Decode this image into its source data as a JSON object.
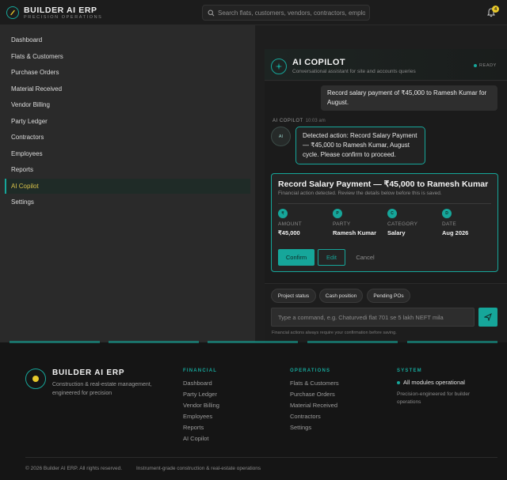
{
  "header": {
    "brand_title": "BUILDER AI ERP",
    "brand_subtitle": "PRECISION OPERATIONS",
    "search_placeholder": "Search flats, customers, vendors, contractors, employees",
    "notification_count": "4",
    "logo_icon": "compass-gauge-icon",
    "search_icon": "search-icon",
    "bell_icon": "bell-icon"
  },
  "sidebar": {
    "items": [
      {
        "label": "Dashboard"
      },
      {
        "label": "Flats & Customers"
      },
      {
        "label": "Purchase Orders"
      },
      {
        "label": "Material Received"
      },
      {
        "label": "Vendor Billing"
      },
      {
        "label": "Party Ledger"
      },
      {
        "label": "Contractors"
      },
      {
        "label": "Employees"
      },
      {
        "label": "Reports"
      },
      {
        "label": "AI Copilot",
        "active": true
      },
      {
        "label": "Settings"
      }
    ]
  },
  "copilot": {
    "title": "AI COPILOT",
    "subtitle": "Conversational assistant for site and accounts queries",
    "status": "READY",
    "icon": "sparkle-icon",
    "user_message": "Record salary payment of ₹45,000 to Ramesh Kumar for August.",
    "ai_sender": "AI COPILOT",
    "ai_time": "10:03 am",
    "ai_avatar": "AI",
    "ai_message": "Detected action: Record Salary Payment — ₹45,000 to Ramesh Kumar, August cycle. Please confirm to proceed."
  },
  "action_card": {
    "title": "Record Salary Payment — ₹45,000 to Ramesh Kumar",
    "subtitle": "Financial action detected. Review the details below before this is saved.",
    "fields": [
      {
        "icon": "₹",
        "label": "AMOUNT",
        "value": "₹45,000"
      },
      {
        "icon": "P",
        "label": "PARTY",
        "value": "Ramesh Kumar"
      },
      {
        "icon": "C",
        "label": "CATEGORY",
        "value": "Salary"
      },
      {
        "icon": "D",
        "label": "DATE",
        "value": "Aug 2026"
      }
    ],
    "confirm_label": "Confirm",
    "edit_label": "Edit",
    "cancel_label": "Cancel"
  },
  "composer": {
    "chips": [
      "Project status",
      "Cash position",
      "Pending POs"
    ],
    "placeholder": "Type a command, e.g. Chaturvedi flat 701 se 5 lakh NEFT mila",
    "hint": "Financial actions always require your confirmation before saving.",
    "send_icon": "send-icon"
  },
  "footer": {
    "brand": "BUILDER AI ERP",
    "description": "Construction & real-estate management, engineered for precision",
    "columns": [
      {
        "title": "FINANCIAL",
        "links": [
          "Dashboard",
          "Party Ledger",
          "Vendor Billing",
          "Employees",
          "Reports",
          "AI Copilot"
        ]
      },
      {
        "title": "OPERATIONS",
        "links": [
          "Flats & Customers",
          "Purchase Orders",
          "Material Received",
          "Contractors",
          "Settings"
        ]
      }
    ],
    "system_title": "SYSTEM",
    "system_status": "All modules operational",
    "system_desc": "Precision-engineered for builder operations",
    "copyright": "© 2026 Builder AI ERP. All rights reserved.",
    "tagline": "Instrument-grade construction & real-estate operations"
  },
  "colors": {
    "accent": "#16a69a",
    "active_nav_text": "#d9c24a",
    "badge": "#e9c92a"
  }
}
